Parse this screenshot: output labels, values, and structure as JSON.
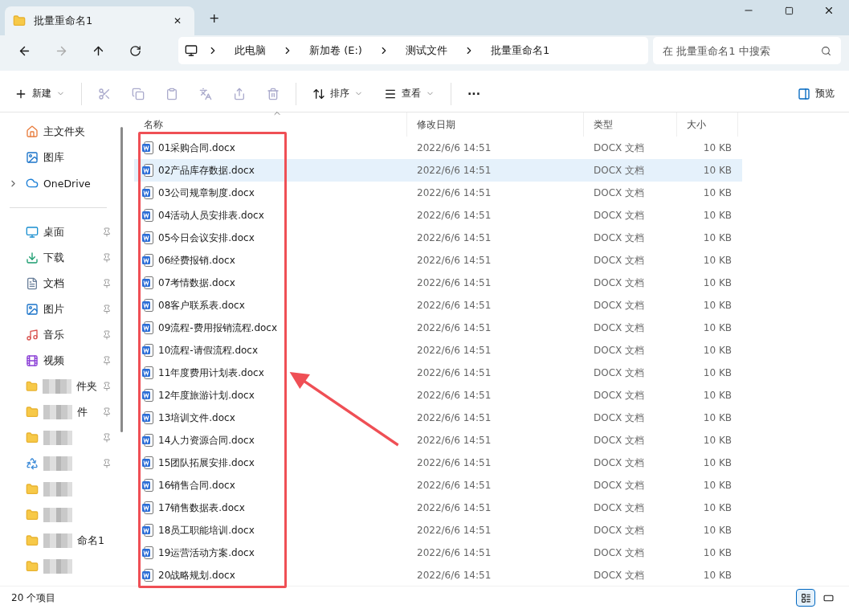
{
  "tab": {
    "title": "批量重命名1",
    "close": "✕",
    "new": "+"
  },
  "address": {
    "crumbs": [
      "此电脑",
      "新加卷 (E:)",
      "测试文件",
      "批量重命名1"
    ],
    "search_placeholder": "在 批量重命名1 中搜索"
  },
  "toolbar": {
    "new": "新建",
    "sort": "排序",
    "view": "查看",
    "more": "···",
    "preview": "预览"
  },
  "sidebar": {
    "top": [
      {
        "label": "主文件夹",
        "kind": "home",
        "expandable": false
      },
      {
        "label": "图库",
        "kind": "gallery",
        "expandable": false
      },
      {
        "label": "OneDrive",
        "kind": "cloud",
        "expandable": true
      }
    ],
    "pinned": [
      {
        "label": "桌面",
        "kind": "desktop",
        "pinned": true,
        "redacted": false
      },
      {
        "label": "下载",
        "kind": "download",
        "pinned": true,
        "redacted": false
      },
      {
        "label": "文档",
        "kind": "docs",
        "pinned": true,
        "redacted": false
      },
      {
        "label": "图片",
        "kind": "pictures",
        "pinned": true,
        "redacted": false
      },
      {
        "label": "音乐",
        "kind": "music",
        "pinned": true,
        "redacted": false
      },
      {
        "label": "视频",
        "kind": "video",
        "pinned": true,
        "redacted": false
      },
      {
        "label": "件夹",
        "kind": "folder",
        "pinned": true,
        "redacted": true
      },
      {
        "label": "件",
        "kind": "folder",
        "pinned": true,
        "redacted": true
      },
      {
        "kind": "folder",
        "pinned": true,
        "redacted": true
      },
      {
        "kind": "recycle",
        "pinned": true,
        "redacted": true
      },
      {
        "kind": "folder",
        "pinned": false,
        "redacted": true
      },
      {
        "kind": "folder",
        "pinned": false,
        "redacted": true
      },
      {
        "label": "命名1",
        "kind": "folder",
        "pinned": false,
        "redacted": true
      },
      {
        "kind": "folder",
        "pinned": false,
        "redacted": true
      }
    ]
  },
  "table": {
    "columns": [
      "名称",
      "修改日期",
      "类型",
      "大小"
    ],
    "rows": [
      {
        "name": "01采购合同.docx",
        "date": "2022/6/6 14:51",
        "type": "DOCX 文档",
        "size": "10 KB",
        "hovered": false
      },
      {
        "name": "02产品库存数据.docx",
        "date": "2022/6/6 14:51",
        "type": "DOCX 文档",
        "size": "10 KB",
        "hovered": true
      },
      {
        "name": "03公司规章制度.docx",
        "date": "2022/6/6 14:51",
        "type": "DOCX 文档",
        "size": "10 KB",
        "hovered": false
      },
      {
        "name": "04活动人员安排表.docx",
        "date": "2022/6/6 14:51",
        "type": "DOCX 文档",
        "size": "10 KB",
        "hovered": false
      },
      {
        "name": "05今日会议安排.docx",
        "date": "2022/6/6 14:51",
        "type": "DOCX 文档",
        "size": "10 KB",
        "hovered": false
      },
      {
        "name": "06经费报销.docx",
        "date": "2022/6/6 14:51",
        "type": "DOCX 文档",
        "size": "10 KB",
        "hovered": false
      },
      {
        "name": "07考情数据.docx",
        "date": "2022/6/6 14:51",
        "type": "DOCX 文档",
        "size": "10 KB",
        "hovered": false
      },
      {
        "name": "08客户联系表.docx",
        "date": "2022/6/6 14:51",
        "type": "DOCX 文档",
        "size": "10 KB",
        "hovered": false
      },
      {
        "name": "09流程-费用报销流程.docx",
        "date": "2022/6/6 14:51",
        "type": "DOCX 文档",
        "size": "10 KB",
        "hovered": false
      },
      {
        "name": "10流程-请假流程.docx",
        "date": "2022/6/6 14:51",
        "type": "DOCX 文档",
        "size": "10 KB",
        "hovered": false
      },
      {
        "name": "11年度费用计划表.docx",
        "date": "2022/6/6 14:51",
        "type": "DOCX 文档",
        "size": "10 KB",
        "hovered": false
      },
      {
        "name": "12年度旅游计划.docx",
        "date": "2022/6/6 14:51",
        "type": "DOCX 文档",
        "size": "10 KB",
        "hovered": false
      },
      {
        "name": "13培训文件.docx",
        "date": "2022/6/6 14:51",
        "type": "DOCX 文档",
        "size": "10 KB",
        "hovered": false
      },
      {
        "name": "14人力资源合同.docx",
        "date": "2022/6/6 14:51",
        "type": "DOCX 文档",
        "size": "10 KB",
        "hovered": false
      },
      {
        "name": "15团队拓展安排.docx",
        "date": "2022/6/6 14:51",
        "type": "DOCX 文档",
        "size": "10 KB",
        "hovered": false
      },
      {
        "name": "16销售合同.docx",
        "date": "2022/6/6 14:51",
        "type": "DOCX 文档",
        "size": "10 KB",
        "hovered": false
      },
      {
        "name": "17销售数据表.docx",
        "date": "2022/6/6 14:51",
        "type": "DOCX 文档",
        "size": "10 KB",
        "hovered": false
      },
      {
        "name": "18员工职能培训.docx",
        "date": "2022/6/6 14:51",
        "type": "DOCX 文档",
        "size": "10 KB",
        "hovered": false
      },
      {
        "name": "19运营活动方案.docx",
        "date": "2022/6/6 14:51",
        "type": "DOCX 文档",
        "size": "10 KB",
        "hovered": false
      },
      {
        "name": "20战略规划.docx",
        "date": "2022/6/6 14:51",
        "type": "DOCX 文档",
        "size": "10 KB",
        "hovered": false
      }
    ]
  },
  "status": {
    "count": "20 个项目",
    "views": [
      {
        "kind": "details",
        "selected": true
      },
      {
        "kind": "tiles",
        "selected": false
      }
    ]
  }
}
